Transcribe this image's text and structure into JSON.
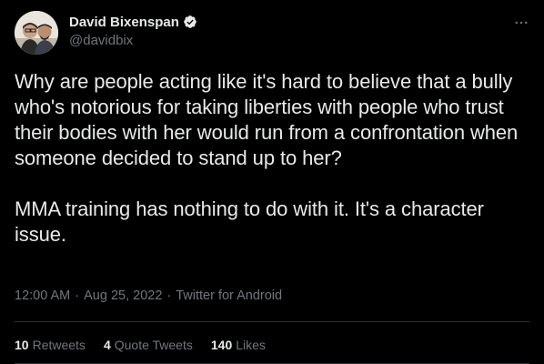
{
  "author": {
    "display_name": "David Bixenspan",
    "handle": "@davidbix",
    "verified": true
  },
  "tweet": {
    "text": "Why are people acting like it's hard to believe that a bully who's notorious for taking liberties with people who trust their bodies with her would run from a confrontation when someone decided to stand up to her?\n\nMMA training has nothing to do with it. It's a character issue.",
    "time": "12:00 AM",
    "separator": "·",
    "date": "Aug 25, 2022",
    "source": "Twitter for Android"
  },
  "stats": [
    {
      "count": "10",
      "label": "Retweets"
    },
    {
      "count": "4",
      "label": "Quote Tweets"
    },
    {
      "count": "140",
      "label": "Likes"
    }
  ],
  "icons": {
    "more": "more-horizontal-icon",
    "verified": "verified-badge-icon"
  },
  "colors": {
    "background": "#000000",
    "primary_text": "#e7e9ea",
    "secondary_text": "#71767b",
    "divider": "#2f3336",
    "verified": "#e7e9ea"
  }
}
